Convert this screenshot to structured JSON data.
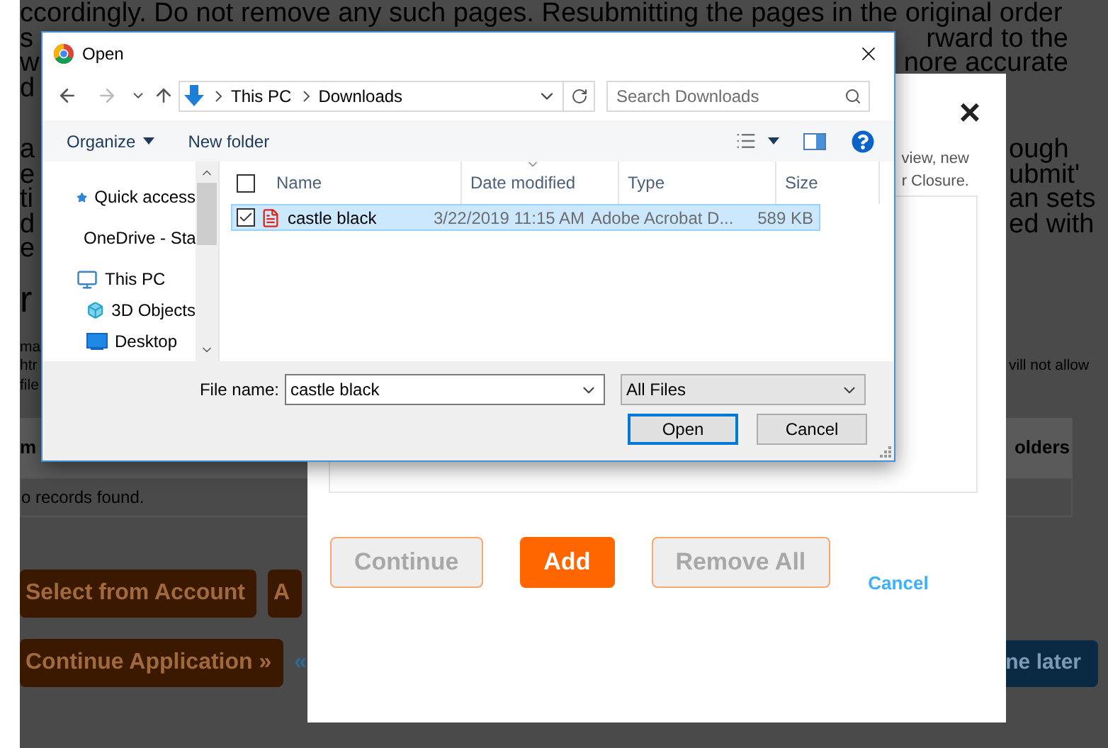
{
  "background_page": {
    "paragraphs": [
      {
        "kind": "body",
        "lines": [
          {
            "left": "ccordingly. Do not remove any such pages. Resubmitting the pages in the original order"
          },
          {
            "left": "s",
            "right": "rward to the"
          },
          {
            "left": "w",
            "right": "nore accurate"
          },
          {
            "left": "d"
          }
        ]
      },
      {
        "kind": "body",
        "lines": [
          {
            "left": "a",
            "right": "ough"
          },
          {
            "left": "e",
            "right": "ubmit'"
          },
          {
            "left": "ti",
            "right": "an sets"
          },
          {
            "left": "d",
            "right": "ed with"
          },
          {
            "left": "e"
          }
        ]
      },
      {
        "kind": "heading",
        "lines": [
          {
            "left": "r"
          }
        ]
      },
      {
        "kind": "small",
        "lines": [
          {
            "left": "ma"
          },
          {
            "left": "htr",
            "right": "vill not allow"
          },
          {
            "left": "file"
          }
        ]
      }
    ],
    "table": {
      "header_left": "m",
      "header_right": "olders",
      "empty_note": "o records found."
    },
    "button_rows": [
      {
        "left": [
          {
            "label": "Select from Account",
            "kind": "orange"
          },
          {
            "label": "A",
            "kind": "orange"
          }
        ]
      },
      {
        "left": [
          {
            "label": "Continue Application »",
            "kind": "orange"
          },
          {
            "label": "«",
            "kind": "link"
          }
        ],
        "right": {
          "label": "ne later",
          "kind": "blue"
        }
      }
    ]
  },
  "modal": {
    "close": "×",
    "description_lines": [
      "view, new",
      "r Closure."
    ],
    "buttons": [
      {
        "label": "Continue",
        "kind": "outline",
        "disabled": true
      },
      {
        "label": "Add",
        "kind": "primary",
        "disabled": false
      },
      {
        "label": "Remove All",
        "kind": "outline",
        "disabled": true
      },
      {
        "label": "Cancel",
        "kind": "link",
        "disabled": false
      }
    ]
  },
  "file_dialog": {
    "title": "Open",
    "path": [
      "This PC",
      "Downloads"
    ],
    "search": {
      "placeholder": "Search Downloads"
    },
    "toolbar": [
      "Organize",
      "New folder"
    ],
    "nav_items": [
      {
        "label": "Quick access",
        "kind": "star"
      },
      {
        "label": "OneDrive - Sta",
        "kind": "cloud"
      },
      {
        "label": "This PC",
        "kind": "pc",
        "children": [
          {
            "label": "3D Objects",
            "kind": "cube"
          },
          {
            "label": "Desktop",
            "kind": "desktop"
          }
        ]
      }
    ],
    "columns": [
      {
        "label": "Name",
        "sorted": false
      },
      {
        "label": "Date modified",
        "sorted": true
      },
      {
        "label": "Type",
        "sorted": false
      },
      {
        "label": "Size",
        "sorted": false
      }
    ],
    "select_all_checked": false,
    "files": [
      {
        "name": "castle black",
        "date": "3/22/2019 11:15 AM",
        "type": "Adobe Acrobat D...",
        "size": "589 KB",
        "selected": true
      }
    ],
    "file_name_label": "File name:",
    "file_name": "castle black",
    "filter": "All Files",
    "buttons": [
      {
        "label": "Open",
        "focused": true
      },
      {
        "label": "Cancel",
        "focused": false
      }
    ]
  }
}
